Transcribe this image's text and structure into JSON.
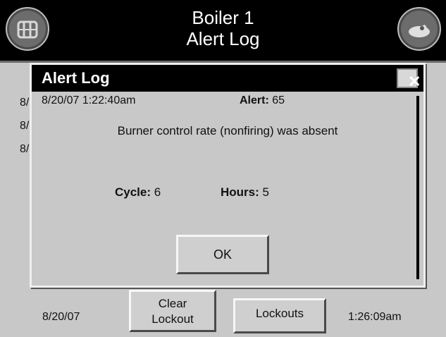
{
  "header": {
    "title_line1": "Boiler 1",
    "title_line2": "Alert Log",
    "left_icon": "boiler-grid-icon",
    "right_icon": "flame-sensor-icon"
  },
  "background_list": {
    "rows": [
      "8/",
      "8/",
      "8/"
    ]
  },
  "dialog": {
    "title": "Alert Log",
    "close_label": "✕",
    "date": "8/20/07 1:22:40am",
    "alert_label": "Alert:",
    "alert_value": "65",
    "message": "Burner control rate (nonfiring) was absent",
    "cycle_label": "Cycle:",
    "cycle_value": "6",
    "hours_label": "Hours:",
    "hours_value": "5",
    "ok_label": "OK"
  },
  "footer": {
    "date": "8/20/07",
    "clear_lockout_line1": "Clear",
    "clear_lockout_line2": "Lockout",
    "lockouts_label": "Lockouts",
    "time": "1:26:09am"
  }
}
